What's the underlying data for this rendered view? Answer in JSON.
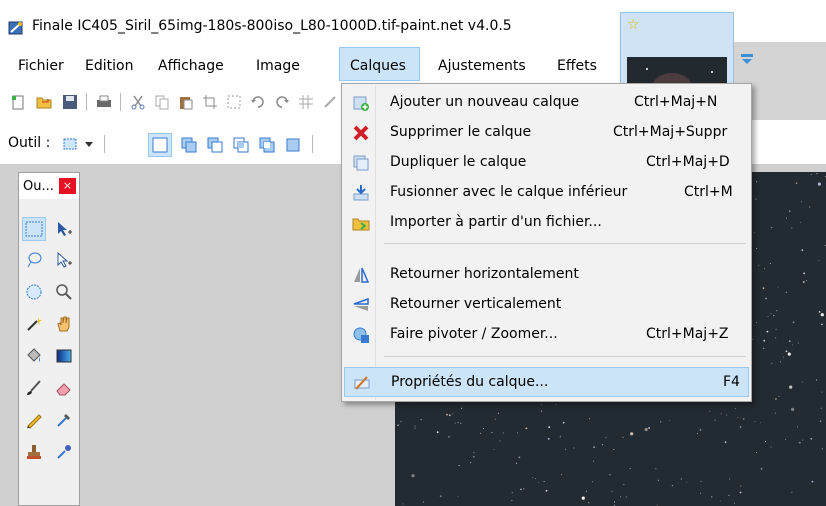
{
  "window": {
    "title": "Finale IC405_Siril_65img-180s-800iso_L80-1000D.tif-paint.net v4.0.5"
  },
  "menubar": {
    "items": [
      "Fichier",
      "Edition",
      "Affichage",
      "Image",
      "Calques",
      "Ajustements",
      "Effets"
    ],
    "active": "Calques"
  },
  "toolbar": {
    "tool_label": "Outil :"
  },
  "tools_panel": {
    "title": "Ou...",
    "close": "×"
  },
  "layers_menu": {
    "items": [
      {
        "label": "Ajouter un nouveau calque",
        "shortcut": "Ctrl+Maj+N",
        "icon": "add-layer-icon"
      },
      {
        "label": "Supprimer le calque",
        "shortcut": "Ctrl+Maj+Suppr",
        "icon": "delete-layer-icon"
      },
      {
        "label": "Dupliquer le calque",
        "shortcut": "Ctrl+Maj+D",
        "icon": "duplicate-layer-icon"
      },
      {
        "label": "Fusionner avec le calque inférieur",
        "shortcut": "Ctrl+M",
        "icon": "merge-down-icon"
      },
      {
        "label": "Importer à partir d'un fichier...",
        "shortcut": "",
        "icon": "import-file-icon"
      },
      {
        "label": "Retourner horizontalement",
        "shortcut": "",
        "icon": "flip-horizontal-icon"
      },
      {
        "label": "Retourner verticalement",
        "shortcut": "",
        "icon": "flip-vertical-icon"
      },
      {
        "label": "Faire pivoter / Zoomer...",
        "shortcut": "Ctrl+Maj+Z",
        "icon": "rotate-zoom-icon"
      },
      {
        "label": "Propriétés du calque...",
        "shortcut": "F4",
        "icon": "layer-properties-icon"
      }
    ],
    "highlighted_index": 8
  },
  "colors": {
    "menu_highlight": "#cce4f7",
    "menu_highlight_border": "#99c9ef",
    "close_button": "#e81123",
    "canvas_bg": "#d0d0d0",
    "image_bg": "#232b32"
  }
}
